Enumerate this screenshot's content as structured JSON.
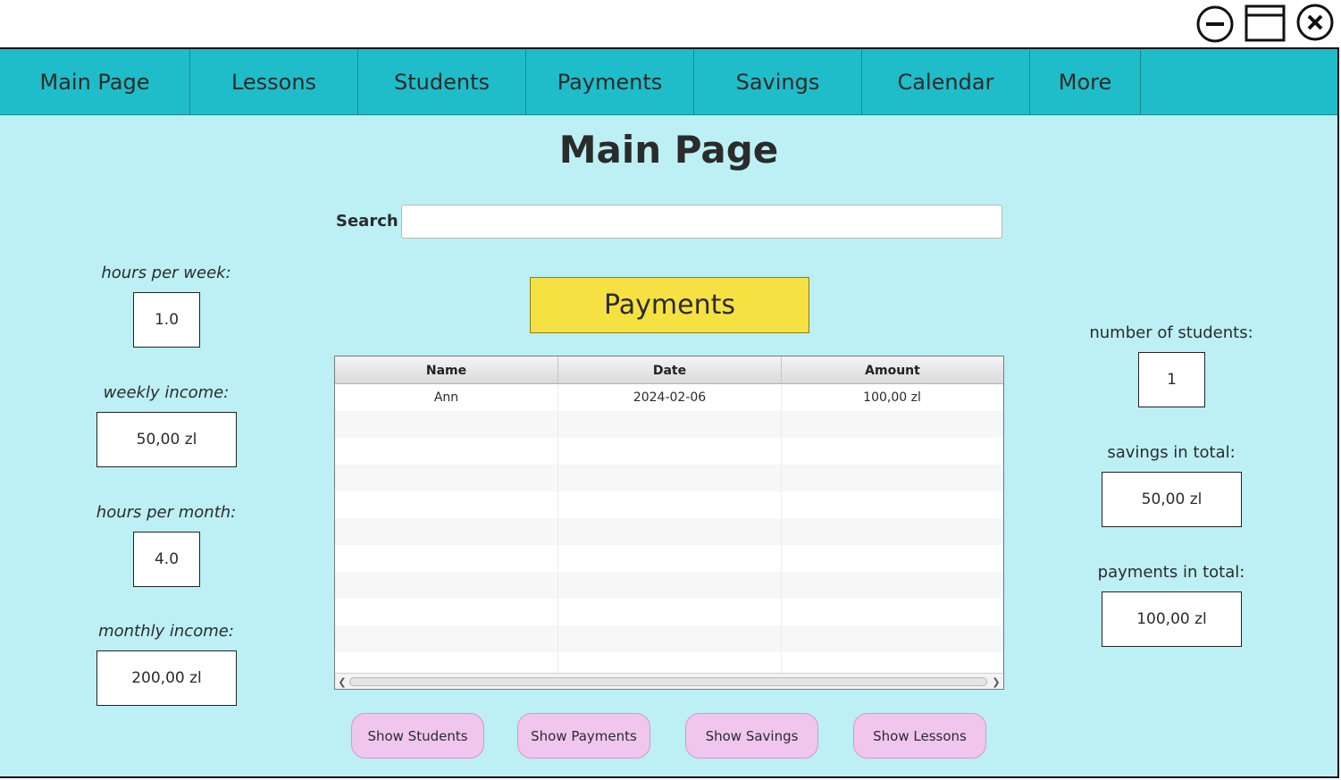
{
  "window": {
    "minimize_icon": "minimize-circle-icon",
    "maximize_icon": "window-maximize-icon",
    "close_icon": "close-circle-icon"
  },
  "nav": {
    "items": [
      {
        "label": "Main Page"
      },
      {
        "label": "Lessons"
      },
      {
        "label": "Students"
      },
      {
        "label": "Payments"
      },
      {
        "label": "Savings"
      },
      {
        "label": "Calendar"
      },
      {
        "label": "More"
      }
    ]
  },
  "page": {
    "title": "Main Page"
  },
  "search": {
    "label": "Search",
    "value": "",
    "placeholder": ""
  },
  "left_stats": {
    "hours_per_week": {
      "label": "hours per week:",
      "value": "1.0"
    },
    "weekly_income": {
      "label": "weekly income:",
      "value": "50,00 zl"
    },
    "hours_per_month": {
      "label": "hours per month:",
      "value": "4.0"
    },
    "monthly_income": {
      "label": "monthly income:",
      "value": "200,00 zl"
    }
  },
  "right_stats": {
    "number_of_students": {
      "label": "number of students:",
      "value": "1"
    },
    "savings_in_total": {
      "label": "savings in total:",
      "value": "50,00 zl"
    },
    "payments_in_total": {
      "label": "payments in total:",
      "value": "100,00 zl"
    }
  },
  "section": {
    "label": "Payments"
  },
  "table": {
    "columns": [
      "Name",
      "Date",
      "Amount"
    ],
    "rows": [
      [
        "Ann",
        "2024-02-06",
        "100,00 zl"
      ]
    ]
  },
  "actions": {
    "show_students": "Show Students",
    "show_payments": "Show Payments",
    "show_savings": "Show Savings",
    "show_lessons": "Show Lessons"
  },
  "colors": {
    "background": "#bcf0f4",
    "navbar": "#1fbdc9",
    "section_button": "#f6e143",
    "pill_button": "#f0c6ee"
  }
}
